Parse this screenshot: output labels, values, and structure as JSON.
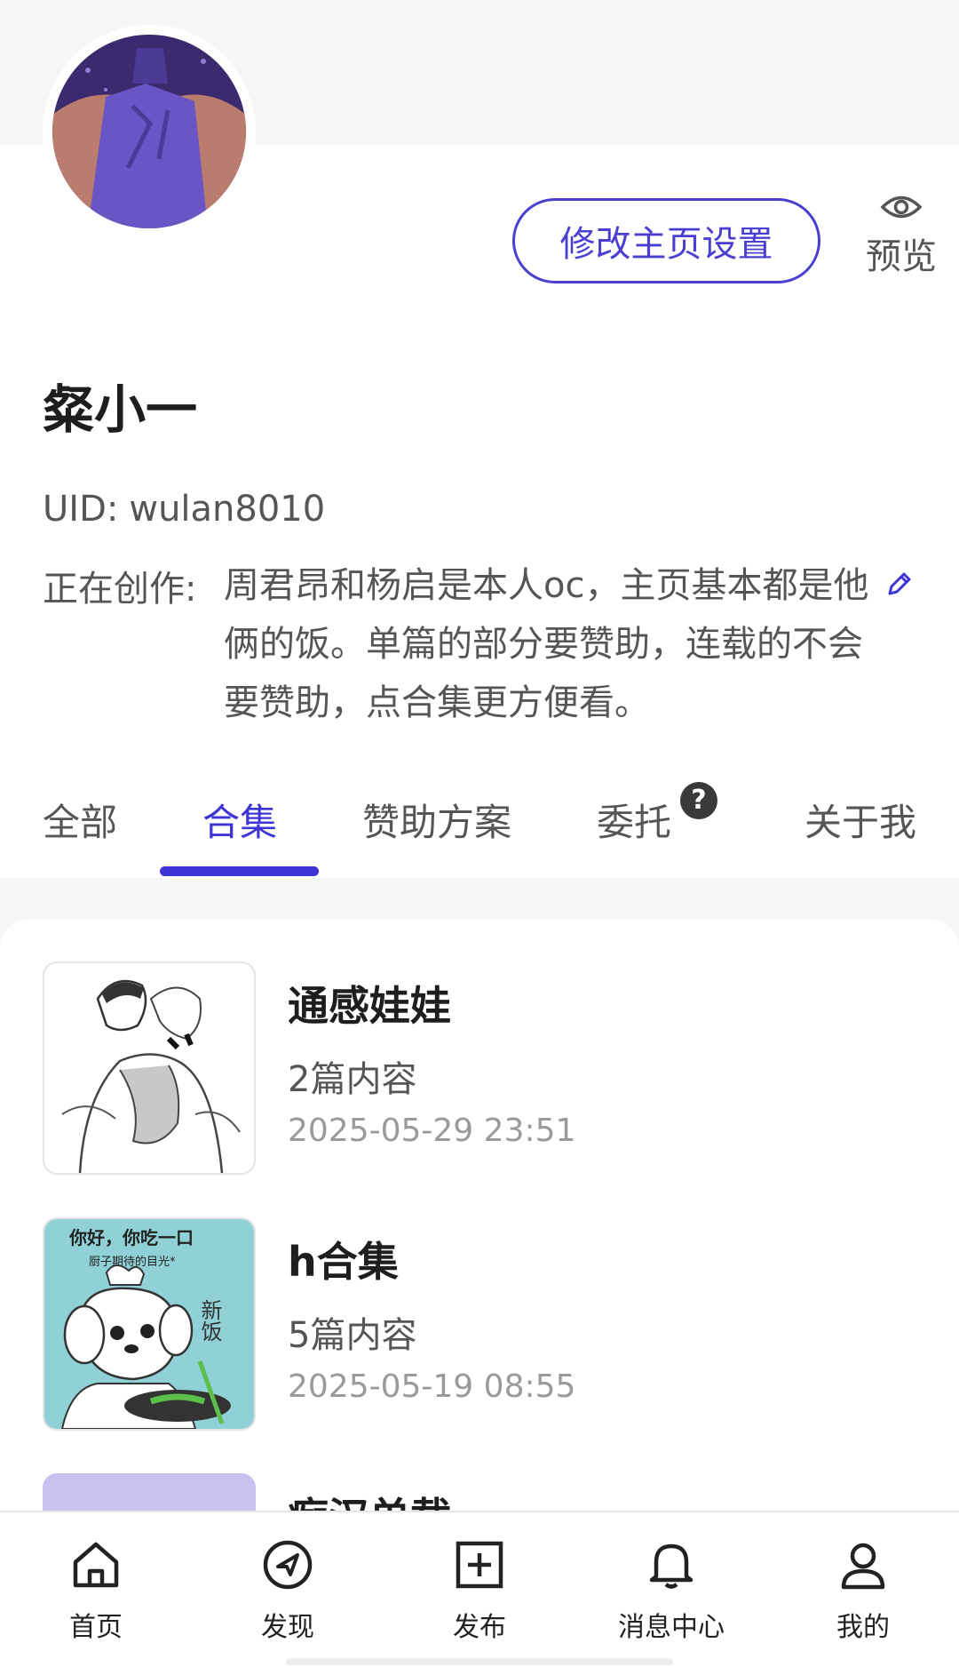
{
  "profile": {
    "username": "粲小一",
    "uid_label": "UID:",
    "uid_value": "wulan8010",
    "creating_label": "正在创作:",
    "creating_text": "周君昂和杨启是本人oc，主页基本都是他俩的饭。单篇的部分要赞助，连载的不会要赞助，点合集更方便看。"
  },
  "actions": {
    "edit_label": "修改主页设置",
    "preview_label": "预览"
  },
  "tabs": [
    {
      "label": "全部",
      "active": false
    },
    {
      "label": "合集",
      "active": true
    },
    {
      "label": "赞助方案",
      "active": false
    },
    {
      "label": "委托",
      "active": false
    },
    {
      "label": "关于我",
      "active": false
    }
  ],
  "commission_help": "?",
  "collections": [
    {
      "title": "通感娃娃",
      "count": "2篇内容",
      "date": "2025-05-29 23:51"
    },
    {
      "title": "h合集",
      "count": "5篇内容",
      "date": "2025-05-19 08:55"
    },
    {
      "title": "痴汉单载",
      "count": "",
      "date": ""
    }
  ],
  "thumb_text": {
    "line1": "你好，你吃一口",
    "line2": "厨子期待的目光*",
    "side": "新饭"
  },
  "bottom_nav": [
    {
      "label": "首页",
      "icon": "home-icon"
    },
    {
      "label": "发现",
      "icon": "compass-icon"
    },
    {
      "label": "发布",
      "icon": "plus-square-icon"
    },
    {
      "label": "消息中心",
      "icon": "bell-icon"
    },
    {
      "label": "我的",
      "icon": "user-icon"
    }
  ],
  "colors": {
    "accent": "#3f35d6",
    "background_band": "#f5f6f7",
    "muted_text": "#555555",
    "date_text": "#9a9a9a"
  }
}
